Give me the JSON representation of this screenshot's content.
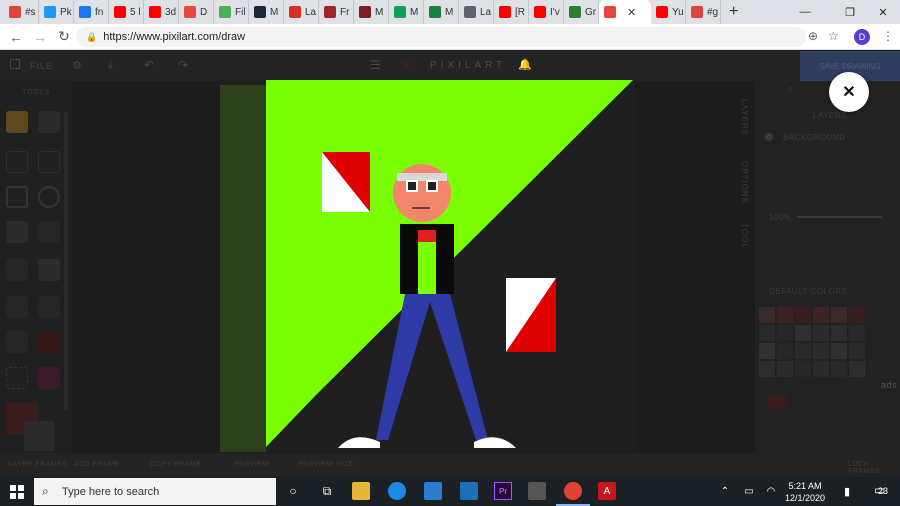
{
  "browser": {
    "tabs": [
      {
        "label": "#s",
        "color": "#e0443e"
      },
      {
        "label": "Pk",
        "color": "#1d9bf0"
      },
      {
        "label": "fn",
        "color": "#1877f2"
      },
      {
        "label": "5 l",
        "color": "#ff0000"
      },
      {
        "label": "3d",
        "color": "#ff0000"
      },
      {
        "label": "D",
        "color": "#e8453c"
      },
      {
        "label": "Fil",
        "color": "#4caf50"
      },
      {
        "label": "M",
        "color": "#1b2838"
      },
      {
        "label": "La",
        "color": "#d93025"
      },
      {
        "label": "Fr",
        "color": "#a0232b"
      },
      {
        "label": "M",
        "color": "#7a1f1f"
      },
      {
        "label": "M",
        "color": "#0f9d58"
      },
      {
        "label": "M",
        "color": "#188038"
      },
      {
        "label": "La",
        "color": "#5f6368"
      },
      {
        "label": "[R",
        "color": "#ff0000"
      },
      {
        "label": "I'v",
        "color": "#ff0000"
      },
      {
        "label": "Gr",
        "color": "#2e7d32"
      },
      {
        "label": "",
        "color": "#e8453c"
      },
      {
        "label": "Yu",
        "color": "#ff0000"
      },
      {
        "label": "#g",
        "color": "#e0443e"
      }
    ],
    "new_tab": "+",
    "window_controls": {
      "minimize": "—",
      "restore": "❐",
      "close": "✕"
    },
    "url": "https://www.pixilart.com/draw",
    "profile_initial": "D"
  },
  "app": {
    "file_label": "FILE",
    "brand": "PIXILART",
    "save_button": "SAVE DRAWING",
    "tools_label": "TOOLS",
    "right_tabs": [
      "LAYERS",
      "OPTIONS",
      "TOOL"
    ],
    "layers_title": "LAYERS",
    "layer_name": "BACKGROUND",
    "opacity": "100%",
    "colors_label": "DEFAULT COLORS",
    "ads_label": "ads",
    "bottom_items": [
      "LAYER FRAMES",
      "ADD FRAME",
      "COPY FRAME",
      "PREVIEW",
      "PREVIEW SIZE",
      "LOCK FRAMES"
    ],
    "close_dialog": "✕"
  },
  "taskbar": {
    "search_placeholder": "Type here to search",
    "time": "5:21 AM",
    "date": "12/1/2020",
    "notification_count": "23"
  }
}
